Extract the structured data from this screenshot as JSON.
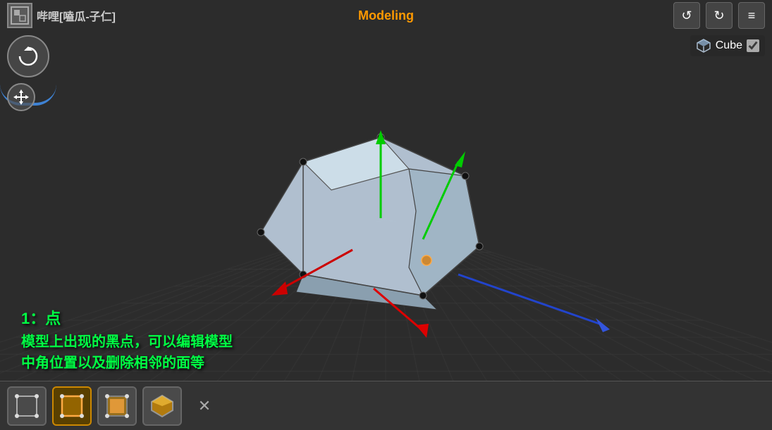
{
  "header": {
    "title": "哔哩[嗑瓜-子仁]",
    "mode": "Modeling",
    "undo_label": "↺",
    "redo_label": "↻",
    "menu_label": "≡"
  },
  "object_panel": {
    "name": "Cube",
    "checkbox_checked": true
  },
  "annotation": {
    "title": "1：点",
    "body": "模型上出现的黑点，可以编辑模型\n中角位置以及删除相邻的面等"
  },
  "bottom_toolbar": {
    "modes": [
      {
        "id": "vertex",
        "label": "点模式",
        "active": false
      },
      {
        "id": "edge",
        "label": "边模式",
        "active": true
      },
      {
        "id": "face",
        "label": "面模式",
        "active": false
      },
      {
        "id": "object",
        "label": "物体模式",
        "active": false
      }
    ],
    "close_label": "✕"
  },
  "nav": {
    "orbit_icon": "↻",
    "pan_icon": "⊕"
  }
}
